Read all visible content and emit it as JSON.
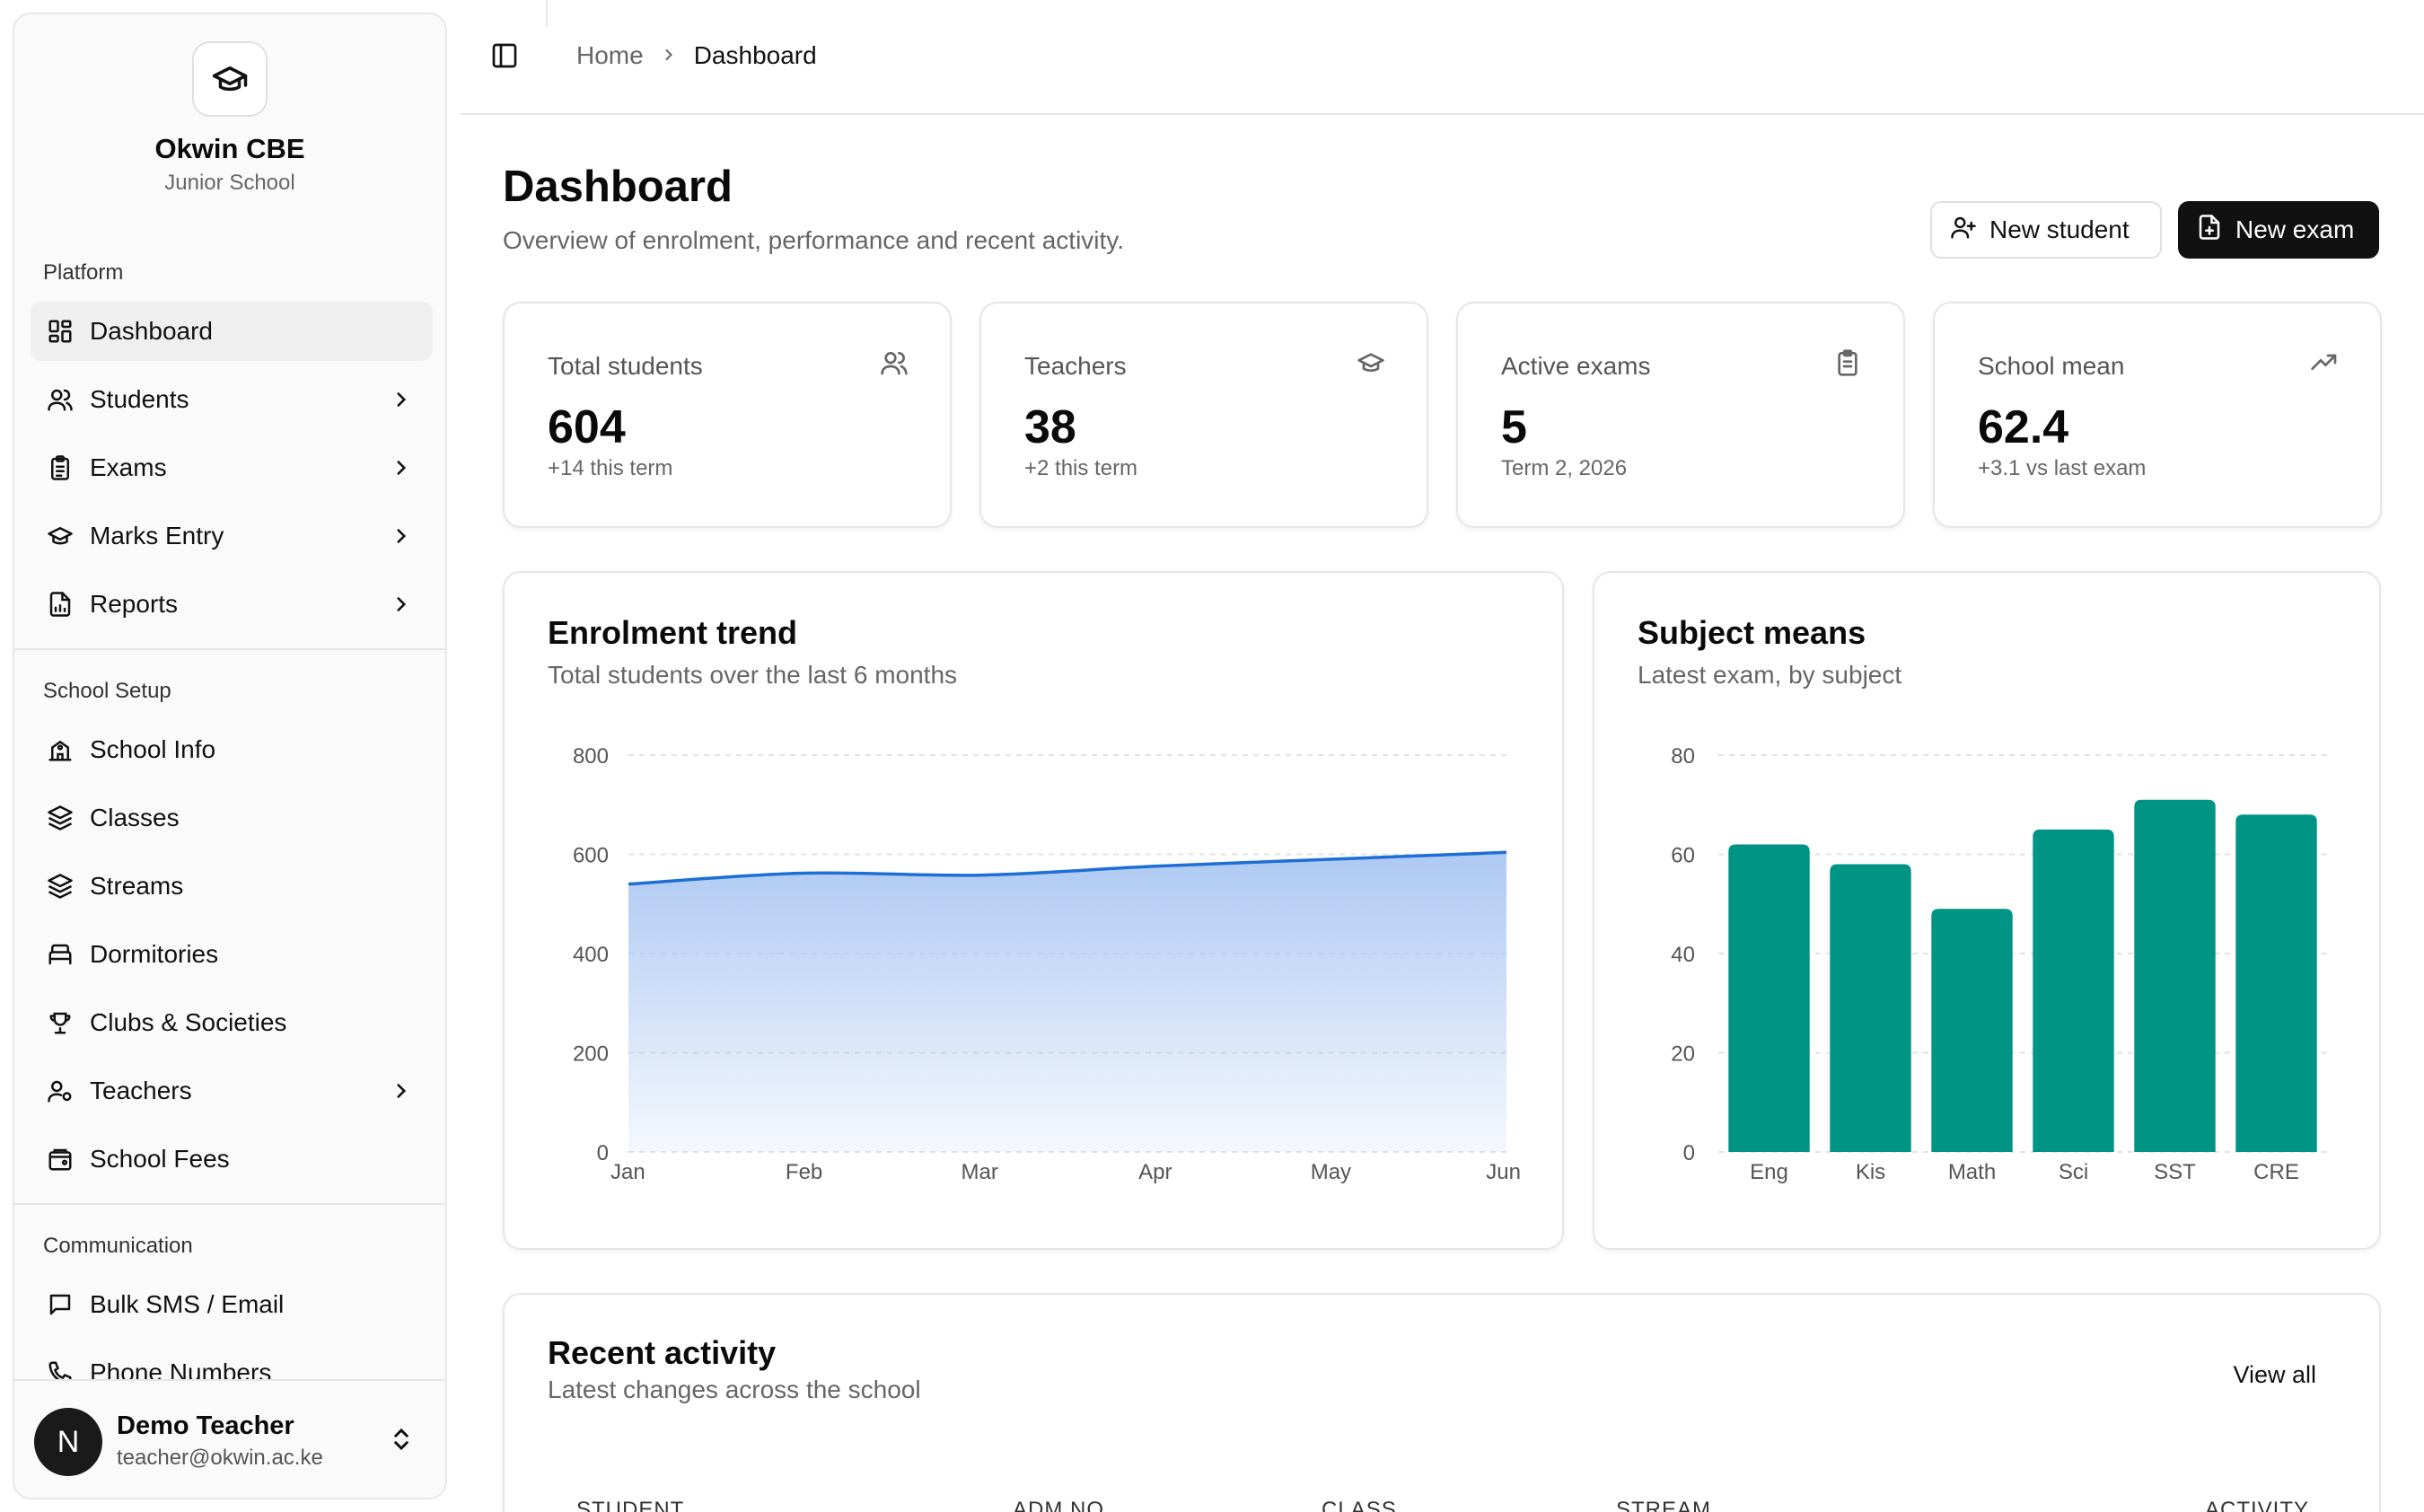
{
  "brand": {
    "name": "Okwin CBE",
    "subtitle": "Junior School"
  },
  "sidebar": {
    "groups": [
      {
        "label": "Platform"
      },
      {
        "label": "School Setup"
      },
      {
        "label": "Communication"
      }
    ],
    "items": [
      {
        "label": "Dashboard",
        "icon": "dashboard-icon"
      },
      {
        "label": "Students",
        "icon": "users-icon"
      },
      {
        "label": "Exams",
        "icon": "clipboard-icon"
      },
      {
        "label": "Marks Entry",
        "icon": "graduation-cap-icon"
      },
      {
        "label": "Reports",
        "icon": "file-chart-icon"
      },
      {
        "label": "School Info",
        "icon": "school-icon"
      },
      {
        "label": "Classes",
        "icon": "layers-icon"
      },
      {
        "label": "Streams",
        "icon": "layers-icon"
      },
      {
        "label": "Dormitories",
        "icon": "bed-icon"
      },
      {
        "label": "Clubs & Societies",
        "icon": "trophy-icon"
      },
      {
        "label": "Teachers",
        "icon": "user-cog-icon"
      },
      {
        "label": "School Fees",
        "icon": "wallet-icon"
      },
      {
        "label": "Bulk SMS / Email",
        "icon": "message-icon"
      },
      {
        "label": "Phone Numbers",
        "icon": "phone-icon"
      }
    ]
  },
  "user": {
    "initial": "N",
    "name": "Demo Teacher",
    "email": "teacher@okwin.ac.ke"
  },
  "breadcrumb": {
    "home": "Home",
    "current": "Dashboard"
  },
  "page": {
    "title": "Dashboard",
    "subtitle": "Overview of enrolment, performance and recent activity.",
    "new_student": "New student",
    "new_exam": "New exam"
  },
  "stats": [
    {
      "label": "Total students",
      "value": "604",
      "note": "+14 this term",
      "icon": "users-icon"
    },
    {
      "label": "Teachers",
      "value": "38",
      "note": "+2 this term",
      "icon": "graduation-cap-icon"
    },
    {
      "label": "Active exams",
      "value": "5",
      "note": "Term 2, 2026",
      "icon": "clipboard-icon"
    },
    {
      "label": "School mean",
      "value": "62.4",
      "note": "+3.1 vs last exam",
      "icon": "trending-up-icon"
    }
  ],
  "enrolment_card": {
    "title": "Enrolment trend",
    "subtitle": "Total students over the last 6 months"
  },
  "subject_card": {
    "title": "Subject means",
    "subtitle": "Latest exam, by subject"
  },
  "activity": {
    "title": "Recent activity",
    "subtitle": "Latest changes across the school",
    "view_all": "View all",
    "columns": [
      "STUDENT",
      "ADM NO.",
      "CLASS",
      "STREAM",
      "ACTIVITY"
    ]
  },
  "colors": {
    "area_line": "#1d6fd6",
    "area_fill": "#a9c6f2",
    "bar": "#009485"
  },
  "chart_data": [
    {
      "type": "area",
      "x": [
        "Jan",
        "Feb",
        "Mar",
        "Apr",
        "May",
        "Jun"
      ],
      "series": [
        {
          "values": [
            540,
            562,
            558,
            576,
            590,
            604
          ]
        }
      ],
      "ylim": [
        0,
        800
      ],
      "yticks": [
        0,
        200,
        400,
        600,
        800
      ],
      "grid": true
    },
    {
      "type": "bar",
      "categories": [
        "Eng",
        "Kis",
        "Math",
        "Sci",
        "SST",
        "CRE"
      ],
      "values": [
        62,
        58,
        49,
        65,
        71,
        68
      ],
      "ylim": [
        0,
        80
      ],
      "yticks": [
        0,
        20,
        40,
        60,
        80
      ],
      "grid": true
    }
  ]
}
